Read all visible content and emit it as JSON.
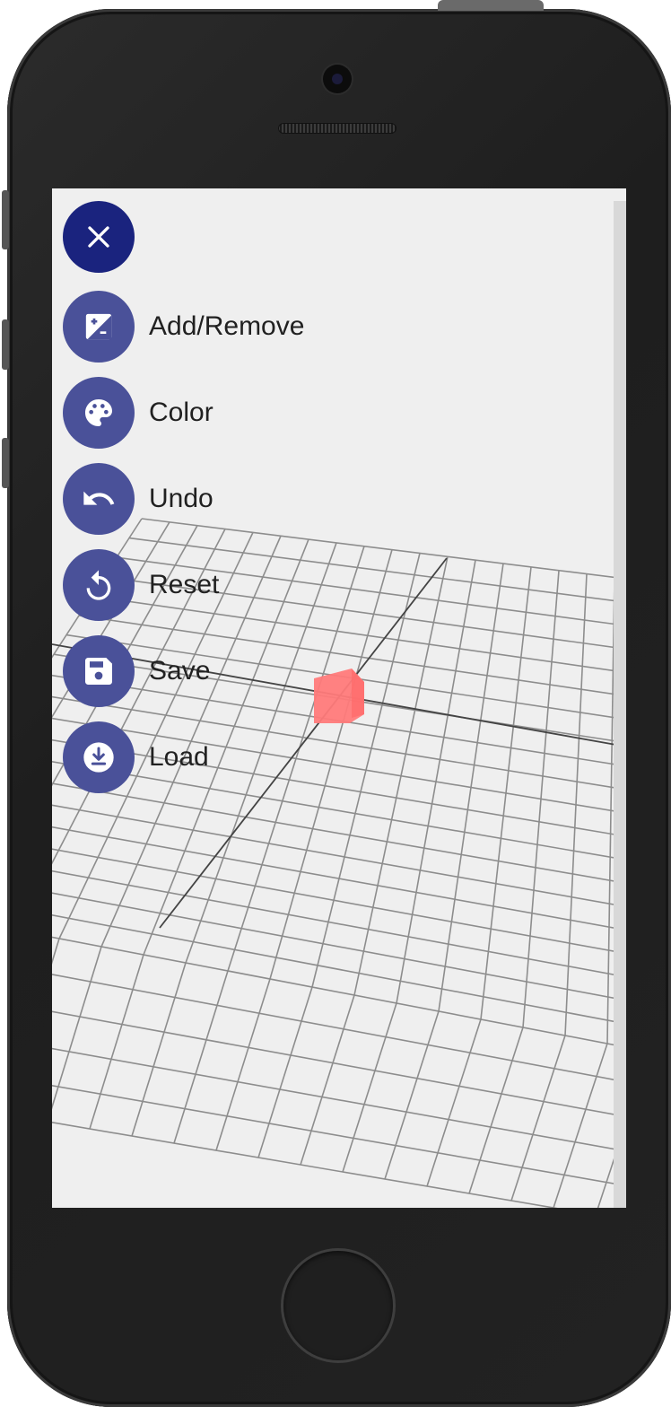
{
  "menu": {
    "close_icon": "close-icon",
    "items": [
      {
        "label": "Add/Remove",
        "icon": "plus-minus-icon"
      },
      {
        "label": "Color",
        "icon": "palette-icon"
      },
      {
        "label": "Undo",
        "icon": "undo-icon"
      },
      {
        "label": "Reset",
        "icon": "reset-icon"
      },
      {
        "label": "Save",
        "icon": "save-icon"
      },
      {
        "label": "Load",
        "icon": "load-icon"
      }
    ]
  },
  "colors": {
    "fab_primary": "#1a237e",
    "fab_secondary": "#4a5199",
    "cube": "#ff7b7b",
    "background": "#efefef"
  }
}
